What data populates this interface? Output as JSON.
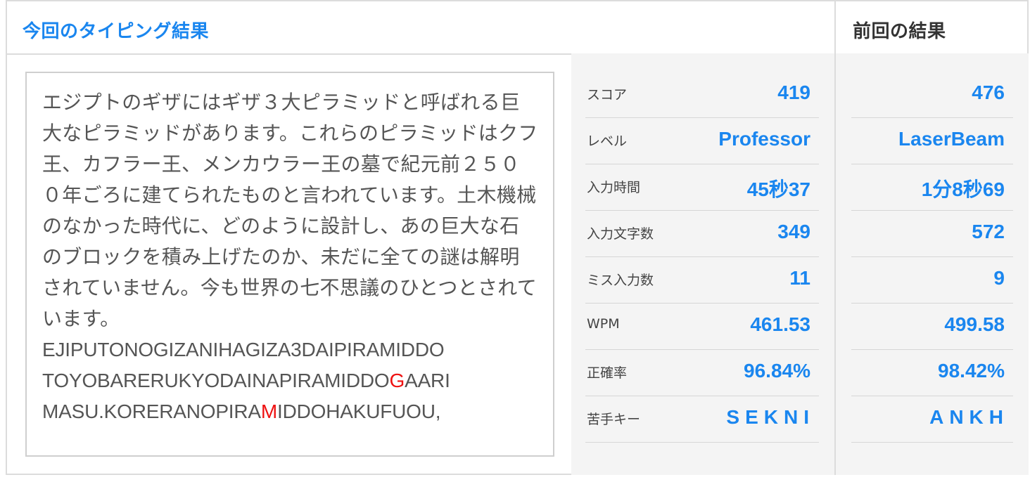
{
  "header": {
    "current_title": "今回のタイピング結果",
    "previous_title": "前回の結果"
  },
  "text": {
    "japanese": "エジプトのギザにはギザ３大ピラミッドと呼ばれる巨大なピラミッドがあります。これらのピラミッドはクフ王、カフラー王、メンカウラー王の墓で紀元前２５００年ごろに建てられたものと言われています。土木機械のなかった時代に、どのように設計し、あの巨大な石のブロックを積み上げたのか、未だに全ての謎は解明されていません。今も世界の七不思議のひとつとされています。",
    "romaji_line1": "EJIPUTONOGIZANIHAGIZA3DAIPIRAMIDDO",
    "romaji_line2_a": "TOYOBARERUKYODAINAPIRAMIDDO",
    "romaji_line2_err": "G",
    "romaji_line2_b": "AARI",
    "romaji_line3_a": "MASU.KORERANOPIRA",
    "romaji_line3_err": "M",
    "romaji_line3_b": "IDDOHAKUFUOU,",
    "error_color": "#e11111"
  },
  "stats": {
    "labels": [
      "スコア",
      "レベル",
      "入力時間",
      "入力文字数",
      "ミス入力数",
      "WPM",
      "正確率",
      "苦手キー"
    ],
    "current": [
      "419",
      "Professor",
      "45秒37",
      "349",
      "11",
      "461.53",
      "96.84%",
      "SEKNI"
    ],
    "previous": [
      "476",
      "LaserBeam",
      "1分8秒69",
      "572",
      "9",
      "499.58",
      "98.42%",
      "ANKH"
    ]
  },
  "colors": {
    "accent": "#1a86ef",
    "panel": "#f4f4f4",
    "border": "#dcdcdc"
  }
}
